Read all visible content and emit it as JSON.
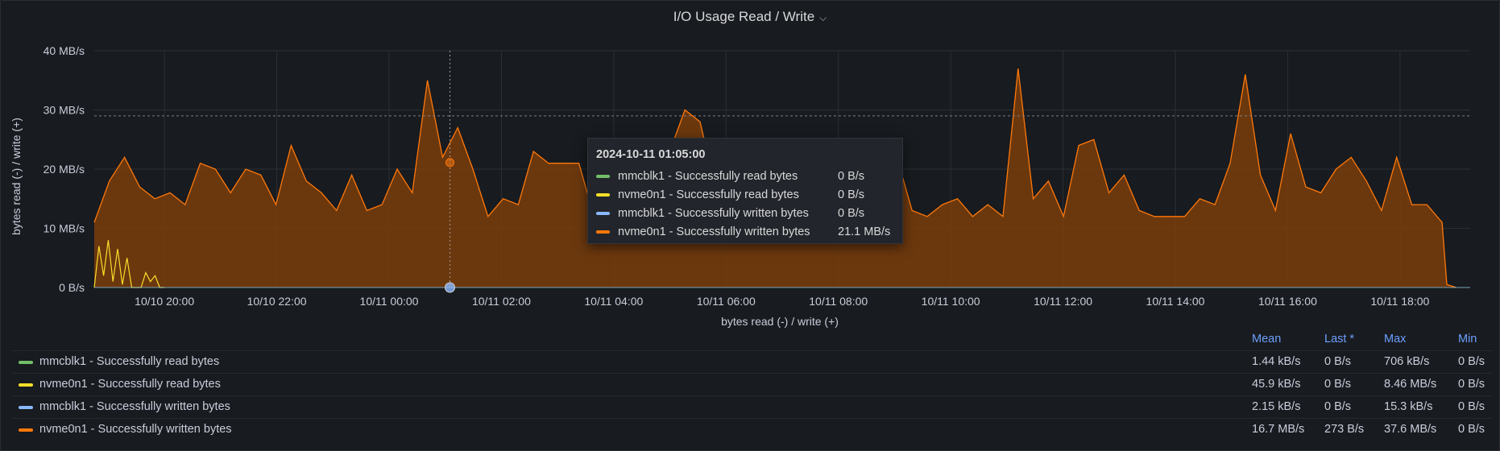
{
  "panel": {
    "title": "I/O Usage Read / Write"
  },
  "colors": {
    "mmcblk1_read": "#73bf69",
    "nvme0n1_read": "#fade2a",
    "mmcblk1_written": "#8ab8ff",
    "nvme0n1_written": "#ff780a"
  },
  "tooltip": {
    "time": "2024-10-11 01:05:00",
    "rows": [
      {
        "name": "mmcblk1 - Successfully read bytes",
        "value": "0 B/s",
        "color": "#73bf69"
      },
      {
        "name": "nvme0n1 - Successfully read bytes",
        "value": "0 B/s",
        "color": "#fade2a"
      },
      {
        "name": "mmcblk1 - Successfully written bytes",
        "value": "0 B/s",
        "color": "#8ab8ff"
      },
      {
        "name": "nvme0n1 - Successfully written bytes",
        "value": "21.1 MB/s",
        "color": "#ff780a"
      }
    ]
  },
  "legend": {
    "headers": {
      "mean": "Mean",
      "last": "Last *",
      "max": "Max",
      "min": "Min"
    },
    "rows": [
      {
        "name": "mmcblk1 - Successfully read bytes",
        "color": "#73bf69",
        "mean": "1.44 kB/s",
        "last": "0 B/s",
        "max": "706 kB/s",
        "min": "0 B/s"
      },
      {
        "name": "nvme0n1 - Successfully read bytes",
        "color": "#fade2a",
        "mean": "45.9 kB/s",
        "last": "0 B/s",
        "max": "8.46 MB/s",
        "min": "0 B/s"
      },
      {
        "name": "mmcblk1 - Successfully written bytes",
        "color": "#8ab8ff",
        "mean": "2.15 kB/s",
        "last": "0 B/s",
        "max": "15.3 kB/s",
        "min": "0 B/s"
      },
      {
        "name": "nvme0n1 - Successfully written bytes",
        "color": "#ff780a",
        "mean": "16.7 MB/s",
        "last": "273 B/s",
        "max": "37.6 MB/s",
        "min": "0 B/s"
      }
    ]
  },
  "chart_data": {
    "type": "area",
    "title": "I/O Usage Read / Write",
    "xlabel": "bytes read (-) / write (+)",
    "ylabel": "bytes read (-) / write (+)",
    "x_tick_labels": [
      "10/10 20:00",
      "10/10 22:00",
      "10/11 00:00",
      "10/11 02:00",
      "10/11 04:00",
      "10/11 06:00",
      "10/11 08:00",
      "10/11 10:00",
      "10/11 12:00",
      "10/11 14:00",
      "10/11 16:00",
      "10/11 18:00"
    ],
    "y_tick_labels": [
      "0 B/s",
      "10 MB/s",
      "20 MB/s",
      "30 MB/s",
      "40 MB/s"
    ],
    "xlim": [
      "2024-10-10 18:45",
      "2024-10-11 19:15"
    ],
    "ylim_mb_s": [
      0,
      40
    ],
    "threshold_mb_s": 29,
    "crosshair_time": "2024-10-11 01:05",
    "grid": true,
    "series": [
      {
        "name": "nvme0n1 - Successfully written bytes",
        "color": "#ff780a",
        "x_start": "2024-10-10 18:45",
        "x_step_minutes": 20,
        "values_mb_s": [
          11,
          18,
          22,
          17,
          15,
          16,
          14,
          21,
          20,
          16,
          20,
          19,
          14,
          24,
          18,
          16,
          13,
          19,
          13,
          14,
          20,
          16,
          35,
          22,
          27,
          20,
          12,
          15,
          14,
          23,
          21,
          21,
          21,
          12,
          19,
          16,
          19,
          22,
          23,
          30,
          28,
          17,
          24,
          14,
          18,
          21,
          12,
          24,
          23,
          18,
          20,
          23,
          22,
          22,
          13,
          12,
          14,
          15,
          12,
          14,
          12,
          37,
          15,
          18,
          12,
          24,
          25,
          16,
          19,
          13,
          12,
          12,
          12,
          15,
          14,
          21,
          36,
          19,
          13,
          26,
          17,
          16,
          20,
          22,
          18,
          13,
          22,
          14,
          14,
          11
        ],
        "series_end": "2024-10-11 18:45",
        "tail": [
          {
            "time": "2024-10-11 18:50",
            "value_mb_s": 0.5
          },
          {
            "time": "2024-10-11 19:00",
            "value_mb_s": 0
          }
        ]
      },
      {
        "name": "nvme0n1 - Successfully read bytes",
        "color": "#fade2a",
        "points": [
          {
            "time": "2024-10-10 18:45",
            "value_mb_s": 0
          },
          {
            "time": "2024-10-10 18:50",
            "value_mb_s": 7
          },
          {
            "time": "2024-10-10 18:55",
            "value_mb_s": 2
          },
          {
            "time": "2024-10-10 19:00",
            "value_mb_s": 8
          },
          {
            "time": "2024-10-10 19:05",
            "value_mb_s": 1
          },
          {
            "time": "2024-10-10 19:10",
            "value_mb_s": 6.5
          },
          {
            "time": "2024-10-10 19:15",
            "value_mb_s": 0.5
          },
          {
            "time": "2024-10-10 19:20",
            "value_mb_s": 5
          },
          {
            "time": "2024-10-10 19:25",
            "value_mb_s": 0
          },
          {
            "time": "2024-10-10 19:30",
            "value_mb_s": 0
          },
          {
            "time": "2024-10-10 19:35",
            "value_mb_s": 0
          },
          {
            "time": "2024-10-10 19:40",
            "value_mb_s": 2.5
          },
          {
            "time": "2024-10-10 19:45",
            "value_mb_s": 1
          },
          {
            "time": "2024-10-10 19:50",
            "value_mb_s": 2
          },
          {
            "time": "2024-10-10 19:55",
            "value_mb_s": 0
          },
          {
            "time": "2024-10-10 20:00",
            "value_mb_s": 0
          }
        ]
      },
      {
        "name": "mmcblk1 - Successfully read bytes",
        "color": "#73bf69",
        "values_mb_s": [
          0
        ]
      },
      {
        "name": "mmcblk1 - Successfully written bytes",
        "color": "#8ab8ff",
        "values_mb_s": [
          0
        ]
      }
    ]
  }
}
